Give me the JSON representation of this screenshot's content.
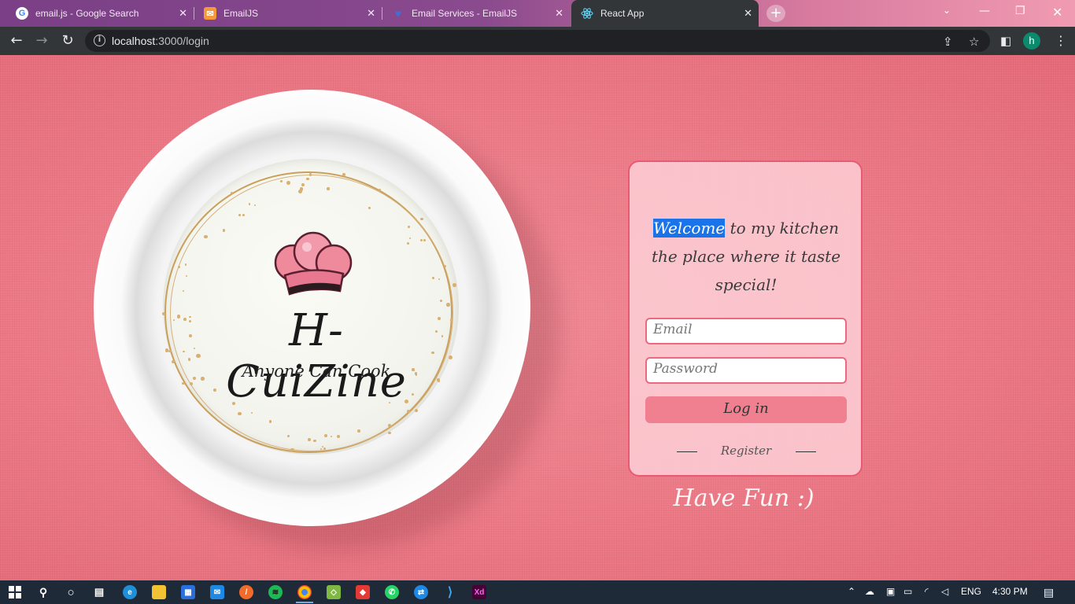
{
  "browser": {
    "tabs": [
      {
        "title": "email.js - Google Search",
        "icon": "google-g-icon",
        "active": false
      },
      {
        "title": "EmailJS",
        "icon": "emailjs-icon",
        "active": false
      },
      {
        "title": "Email Services - EmailJS",
        "icon": "emailjs-heart-icon",
        "active": false
      },
      {
        "title": "React App",
        "icon": "react-icon",
        "active": true
      }
    ],
    "new_tab": "+",
    "close_glyph": "✕",
    "url_host": "localhost",
    "url_rest": ":3000/login",
    "profile_initial": "h"
  },
  "page": {
    "brand_name": "H-CuiZine",
    "brand_tagline": "Anyone Can Cook",
    "welcome_highlight": "Welcome",
    "welcome_rest": " to my kitchen the place where it taste special!",
    "email_placeholder": "Email",
    "password_placeholder": "Password",
    "login_label": "Log in",
    "register_label": "Register",
    "footer_text": "Have Fun :)"
  },
  "taskbar": {
    "language": "ENG",
    "time": "4:30 PM"
  },
  "colors": {
    "page_background": "#e9707e",
    "card_border": "#e85a72",
    "button_background": "#f08090",
    "selection_highlight": "#1a73e8"
  }
}
